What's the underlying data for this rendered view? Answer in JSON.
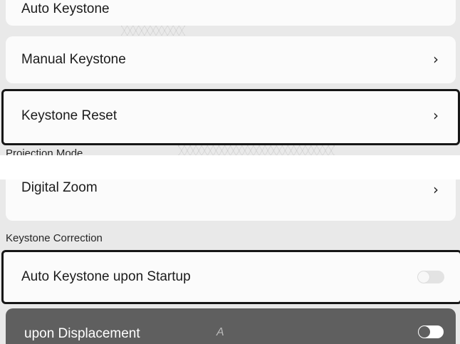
{
  "top_panel": {
    "partial_top_item": "Auto Keystone",
    "items": [
      {
        "label": "Manual Keystone",
        "chevron": "›"
      },
      {
        "label": "Keystone Reset",
        "chevron": "›"
      }
    ],
    "partial_section": "Projection Mode"
  },
  "bottom_panel": {
    "partial_top_item": "Digital Zoom",
    "partial_chevron": "›",
    "section_title": "Keystone Correction",
    "items": [
      {
        "label": "Auto Keystone upon Startup",
        "toggle": "off"
      },
      {
        "label": "upon Displacement",
        "faded_prefix": "A",
        "toggle": "on"
      }
    ]
  },
  "colors": {
    "panel_bg": "#e9e9e9",
    "card_bg": "#fbfbfb",
    "selection_border": "#161616",
    "highlight_bar": "#5f5f5f"
  },
  "icons": [
    "chevron-right-icon",
    "toggle-switch"
  ]
}
